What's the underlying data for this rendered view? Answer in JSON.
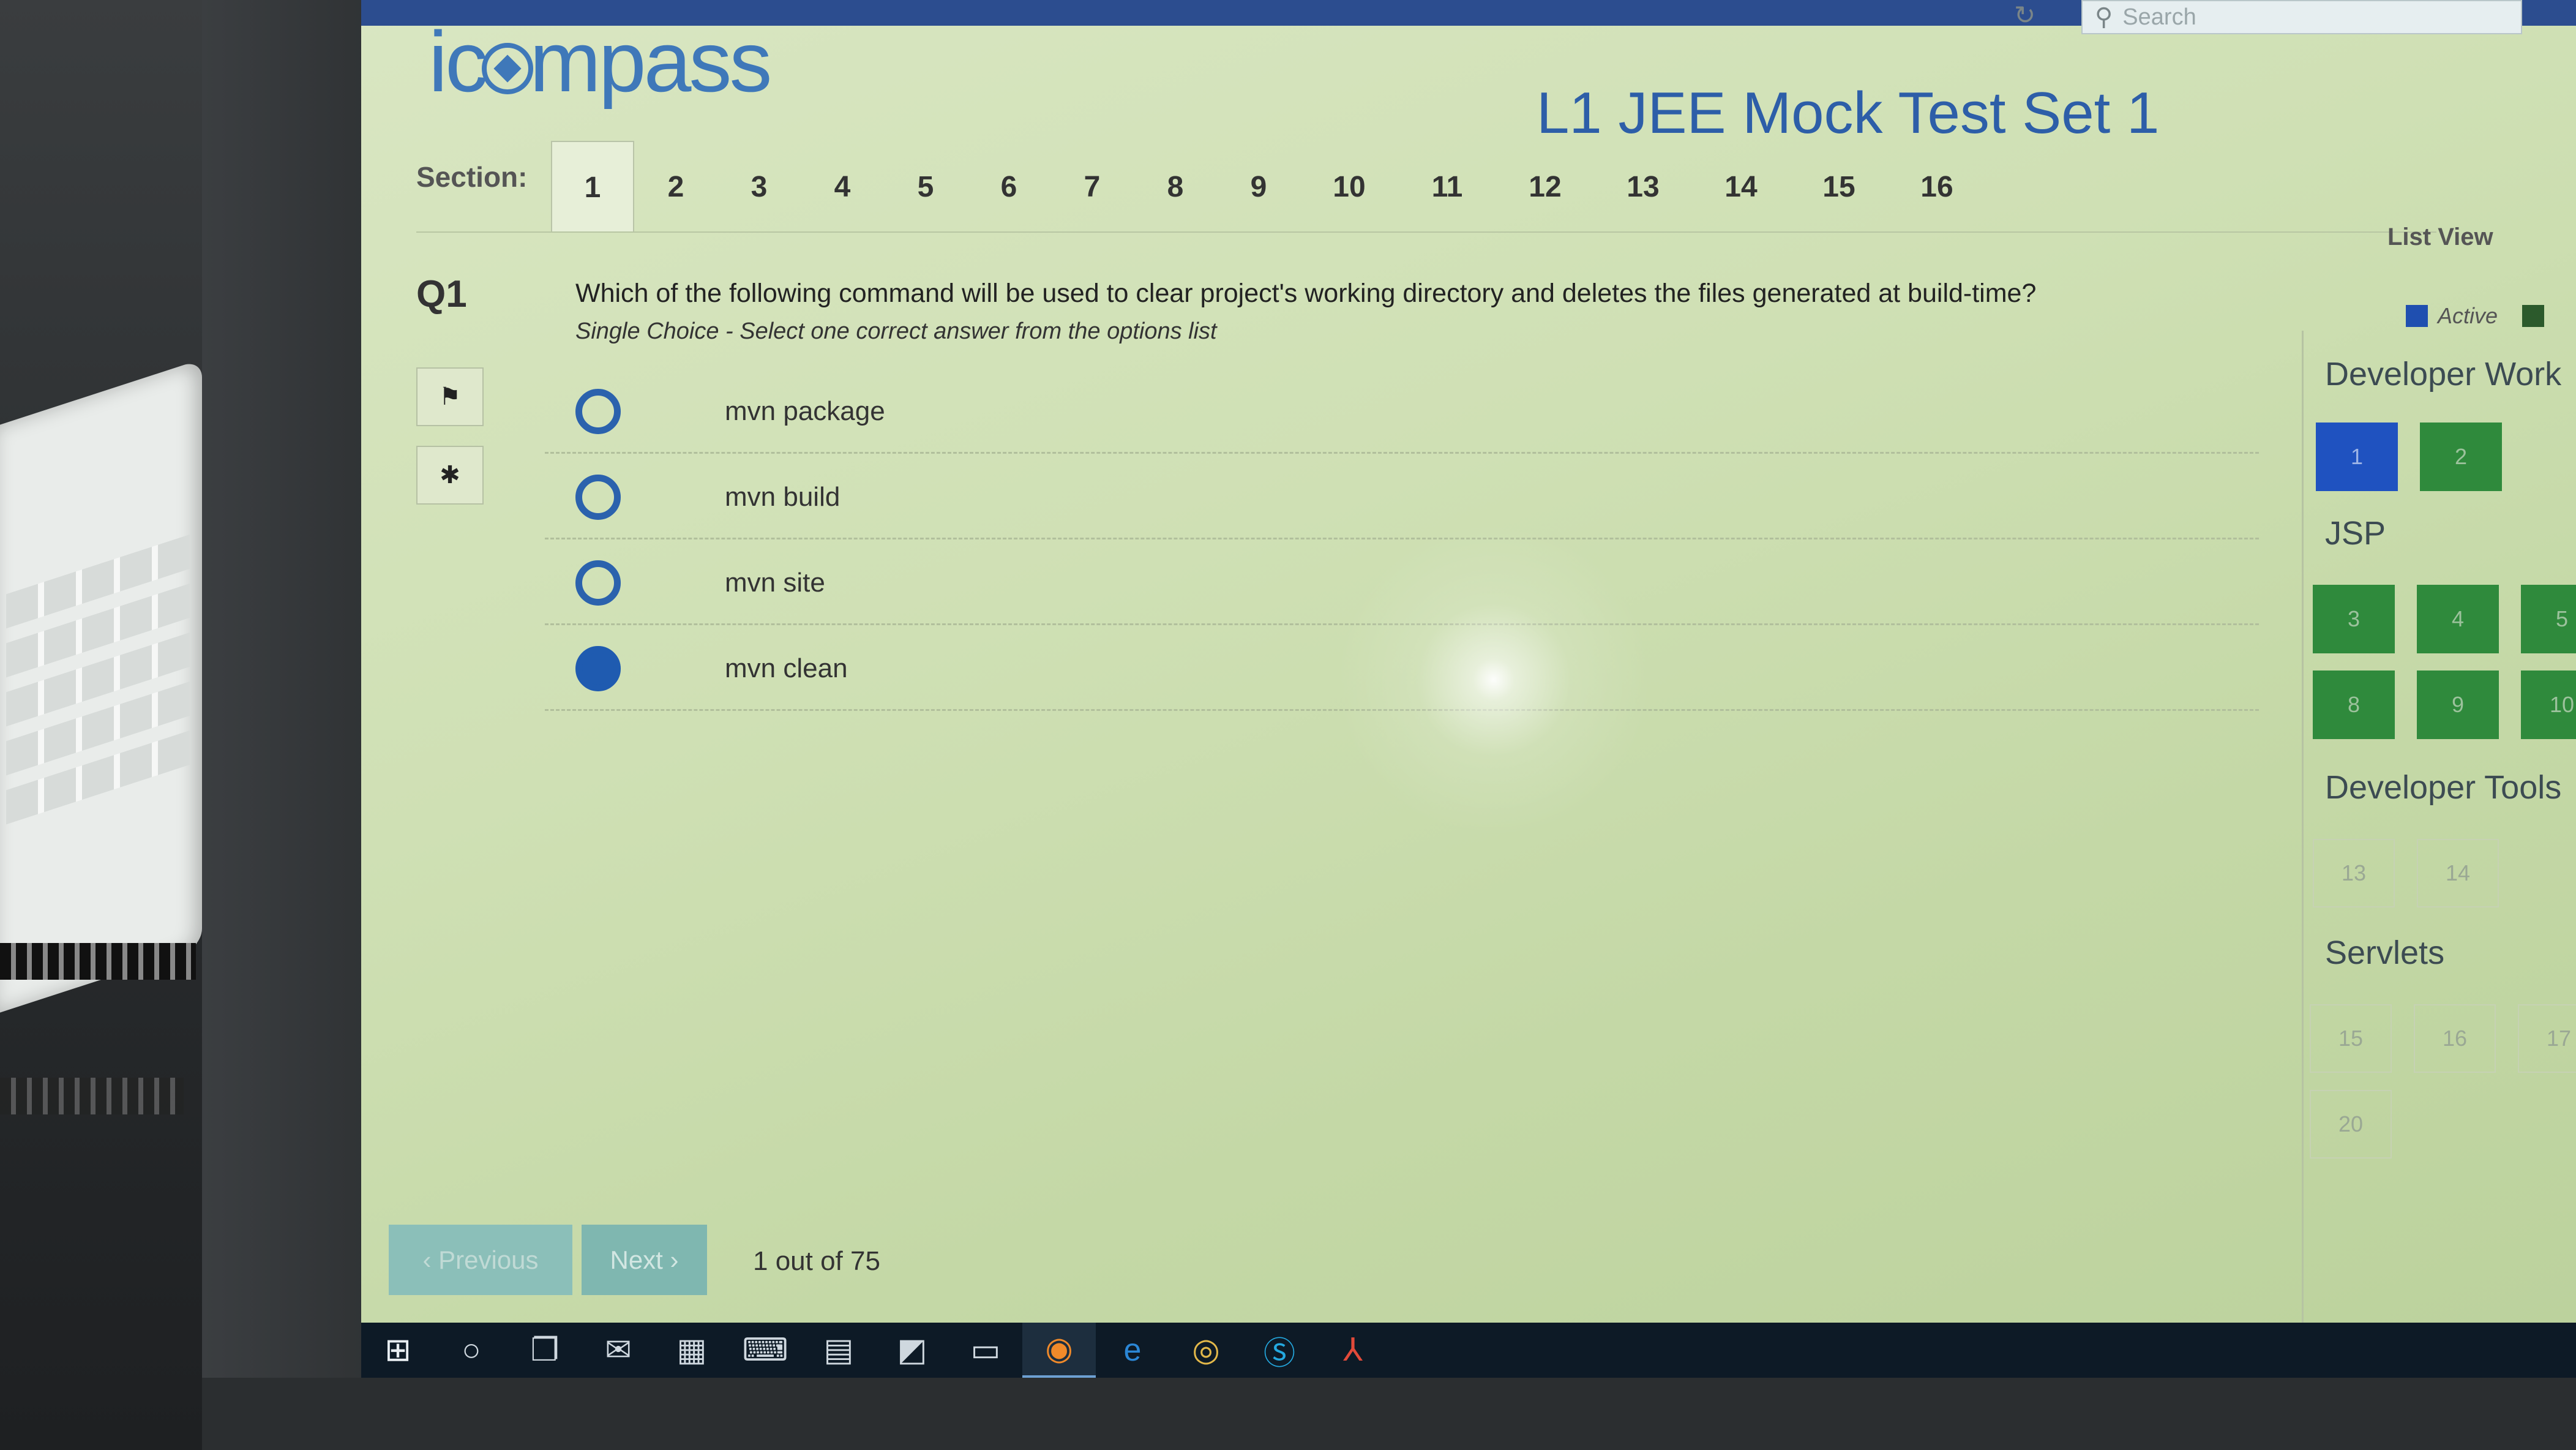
{
  "header": {
    "logo_prefix": "ic",
    "logo_suffix": "mpass",
    "test_title": "L1 JEE Mock Test Set 1",
    "search_placeholder": "Search"
  },
  "sections": {
    "label": "Section:",
    "tabs": [
      "1",
      "2",
      "3",
      "4",
      "5",
      "6",
      "7",
      "8",
      "9",
      "10",
      "11",
      "12",
      "13",
      "14",
      "15",
      "16"
    ],
    "active_tab": "1",
    "list_view_label": "List View"
  },
  "question": {
    "number": "Q1",
    "text": "Which of the following command will be used to clear project's working directory and deletes the files generated at build-time?",
    "instruction": "Single Choice - Select one correct answer from the options list",
    "options": [
      {
        "label": "mvn package",
        "selected": false
      },
      {
        "label": "mvn build",
        "selected": false
      },
      {
        "label": "mvn site",
        "selected": false
      },
      {
        "label": "mvn clean",
        "selected": true
      }
    ]
  },
  "legend": {
    "active_label": "Active"
  },
  "navigator": {
    "categories": [
      {
        "title": "Developer Work",
        "questions": [
          "1",
          "2"
        ]
      },
      {
        "title": "JSP",
        "questions": [
          "3",
          "4",
          "5",
          "8",
          "9",
          "10"
        ]
      },
      {
        "title": "Developer Tools",
        "questions": [
          "13",
          "14"
        ]
      },
      {
        "title": "Servlets",
        "questions": [
          "15",
          "16",
          "17",
          "20"
        ]
      }
    ]
  },
  "footer": {
    "previous_label": "‹ Previous",
    "next_label": "Next ›",
    "counter": "1 out of 75"
  },
  "colors": {
    "brand_blue": "#2d5ea8",
    "active_blue": "#1f52c0",
    "answered_green": "#2f8a3c",
    "nav_teal": "#7fb7b0"
  }
}
